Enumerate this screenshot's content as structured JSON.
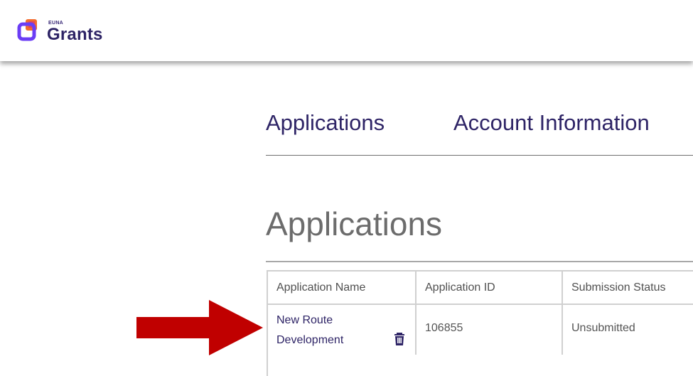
{
  "brand": {
    "small": "EUNA",
    "name": "Grants"
  },
  "nav": {
    "tabs": [
      {
        "label": "Applications"
      },
      {
        "label": "Account Information"
      }
    ]
  },
  "section": {
    "title": "Applications"
  },
  "table": {
    "headers": [
      "Application Name",
      "Application ID",
      "Submission Status"
    ],
    "rows": [
      {
        "name_line1": "New Route",
        "name_line2": "Development",
        "id": "106855",
        "status": "Unsubmitted"
      }
    ]
  },
  "icons": {
    "delete": "trash-icon",
    "pointer": "arrow-right-icon",
    "logo": "euna-logo-icon"
  },
  "colors": {
    "brand_dark": "#2e2466",
    "arrow_red": "#c00000",
    "logo_purple": "#6b3df5",
    "logo_orange": "#f36b2c"
  }
}
